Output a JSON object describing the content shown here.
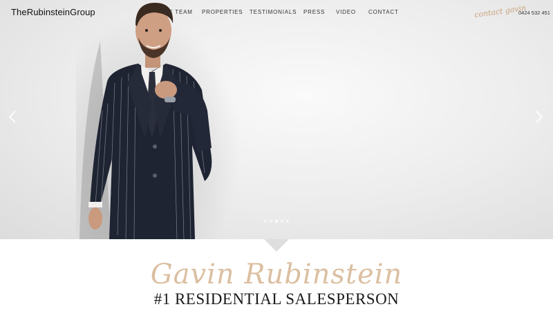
{
  "header": {
    "logo": "TheRubinsteinGroup",
    "nav": [
      "THE TEAM",
      "PROPERTIES",
      "TESTIMONIALS",
      "PRESS",
      "VIDEO",
      "CONTACT"
    ],
    "contact_script": "contact gavin",
    "phone": "0424 532 451"
  },
  "hero": {
    "slide_count": 5,
    "active_slide": 3,
    "prev_icon": "chevron-left-icon",
    "next_icon": "chevron-right-icon"
  },
  "intro": {
    "signature": "Gavin Rubinstein",
    "headline": "#1 RESIDENTIAL SALESPERSON"
  },
  "colors": {
    "accent": "#c9a27a",
    "suit": "#1f2433",
    "text": "#1a1a1a"
  }
}
